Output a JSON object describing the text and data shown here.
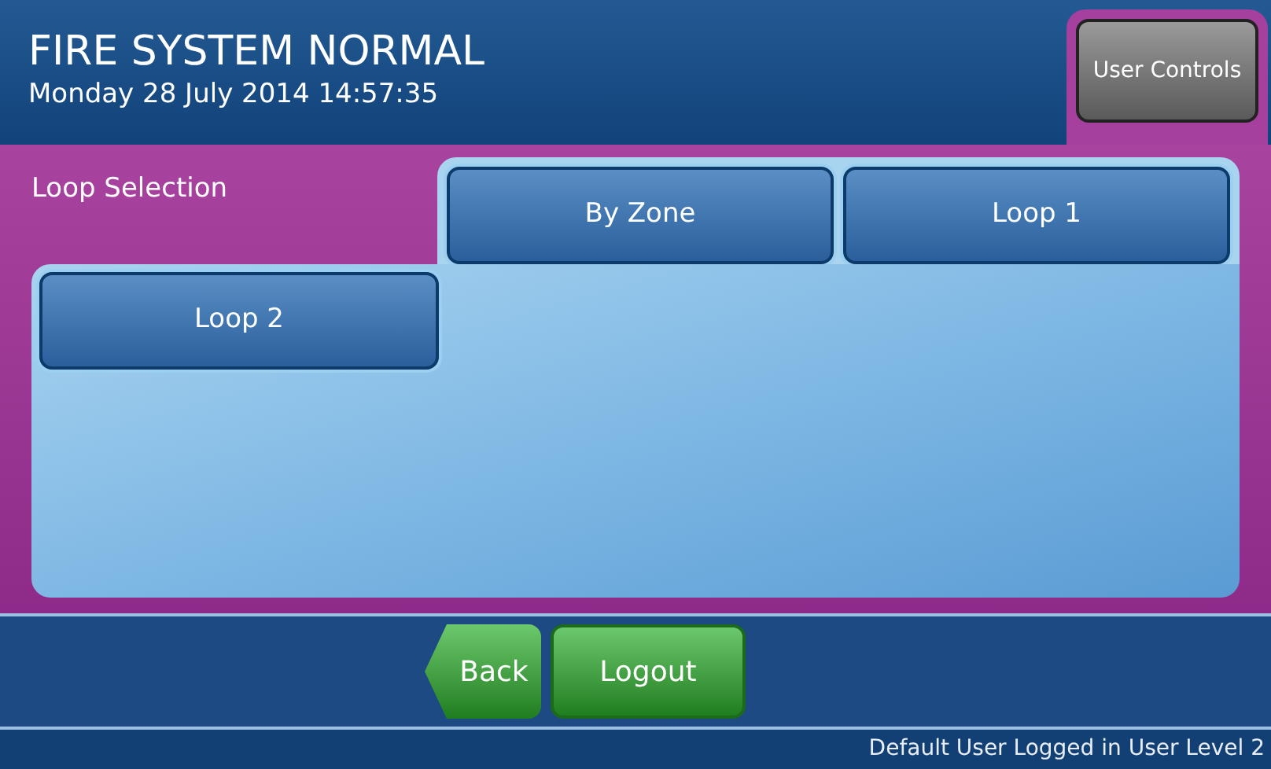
{
  "header": {
    "title": "FIRE SYSTEM NORMAL",
    "datetime": "Monday 28 July 2014 14:57:35",
    "user_controls": "User Controls"
  },
  "panel": {
    "title": "Loop Selection",
    "buttons": [
      "By Zone",
      "Loop 1",
      "Loop 2"
    ]
  },
  "nav": {
    "back": "Back",
    "logout": "Logout"
  },
  "status_bar": "Default User Logged in User Level 2"
}
